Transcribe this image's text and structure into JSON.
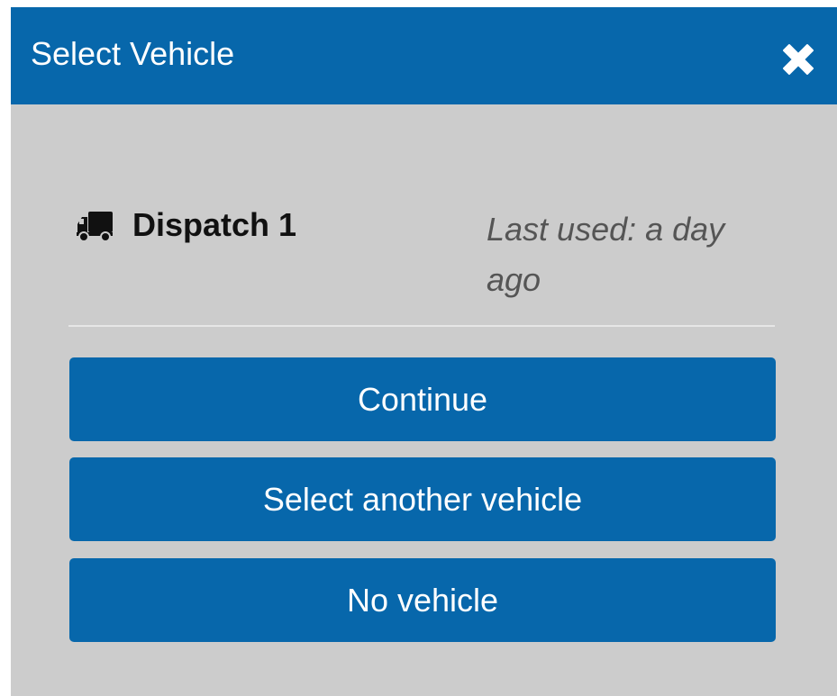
{
  "dialog": {
    "title": "Select Vehicle",
    "close_icon": "close-icon"
  },
  "vehicle": {
    "icon": "truck-icon",
    "name": "Dispatch 1",
    "last_used": "Last used: a day ago"
  },
  "actions": {
    "continue_label": "Continue",
    "select_another_label": "Select another vehicle",
    "no_vehicle_label": "No vehicle"
  },
  "colors": {
    "header": "#0767ab",
    "button": "#0767ab",
    "body": "#cccccc",
    "text_muted": "#555555"
  }
}
